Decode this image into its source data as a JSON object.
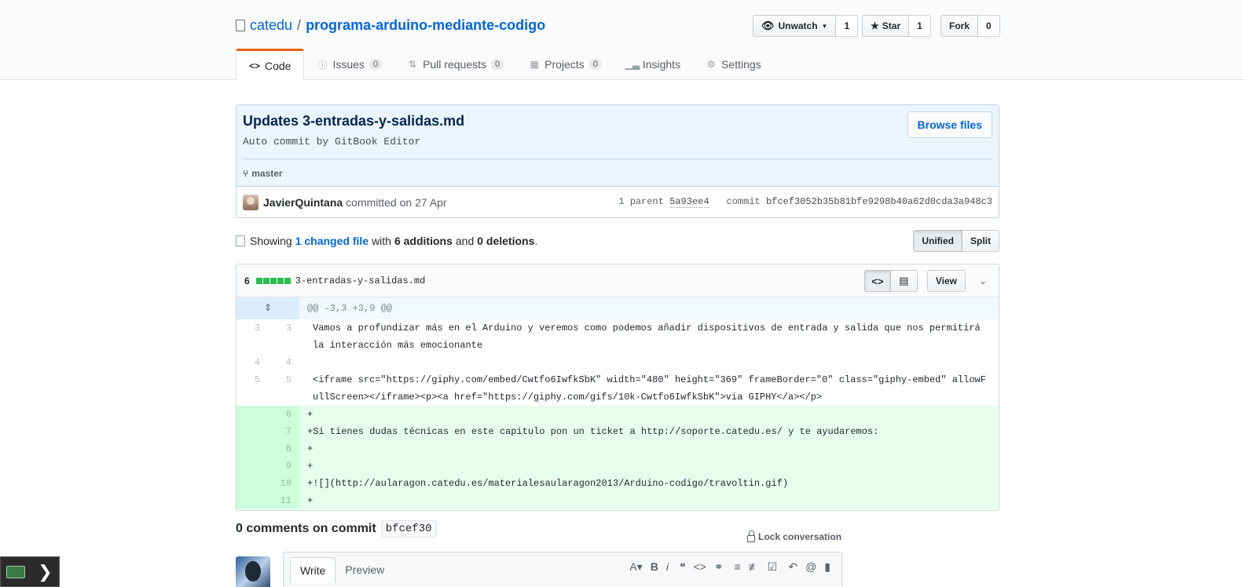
{
  "repo": {
    "owner": "catedu",
    "separator": "/",
    "name": "programa-arduino-mediante-codigo"
  },
  "actions": {
    "watch": {
      "label": "Unwatch",
      "count": "1"
    },
    "star": {
      "label": "Star",
      "count": "1"
    },
    "fork": {
      "label": "Fork",
      "count": "0"
    }
  },
  "tabs": [
    {
      "label": "Code"
    },
    {
      "label": "Issues",
      "count": "0"
    },
    {
      "label": "Pull requests",
      "count": "0"
    },
    {
      "label": "Projects",
      "count": "0"
    },
    {
      "label": "Insights"
    },
    {
      "label": "Settings"
    }
  ],
  "commit": {
    "title": "Updates 3-entradas-y-salidas.md",
    "description": "Auto commit by GitBook Editor",
    "browse_label": "Browse files",
    "branch": "master",
    "author": "JavierQuintana",
    "committed": "committed on 27 Apr",
    "parent_label": "1 parent",
    "parent_sha": "5a93ee4",
    "commit_label": "commit",
    "sha": "bfcef3052b35b81bfe9298b40a62d0cda3a948c3"
  },
  "toc": {
    "showing": "Showing",
    "changed": "1 changed file",
    "with": "with",
    "additions": "6 additions",
    "and": "and",
    "deletions": "0 deletions",
    "period": ".",
    "unified": "Unified",
    "split": "Split"
  },
  "file": {
    "count": "6",
    "name": "3-entradas-y-salidas.md",
    "view_label": "View",
    "hunk": "@@ -3,3 +3,9 @@",
    "lines": [
      {
        "old": "3",
        "new": "3",
        "type": "ctx",
        "text": "Vamos a profundizar más en el Arduino y veremos como podemos añadir dispositivos de entrada y salida que nos permitirá la interacción más emocionante"
      },
      {
        "old": "4",
        "new": "4",
        "type": "ctx",
        "text": ""
      },
      {
        "old": "5",
        "new": "5",
        "type": "ctx",
        "text": "<iframe src=\"https://giphy.com/embed/Cwtfo6IwfkSbK\" width=\"480\" height=\"369\" frameBorder=\"0\" class=\"giphy-embed\" allowFullScreen></iframe><p><a href=\"https://giphy.com/gifs/10k-Cwtfo6IwfkSbK\">via GIPHY</a></p>"
      },
      {
        "old": "",
        "new": "6",
        "type": "add",
        "text": "+"
      },
      {
        "old": "",
        "new": "7",
        "type": "add",
        "text": "+Si tienes dudas técnicas en este capitulo pon un ticket a http://soporte.catedu.es/ y te ayudaremos:"
      },
      {
        "old": "",
        "new": "8",
        "type": "add",
        "text": "+"
      },
      {
        "old": "",
        "new": "9",
        "type": "add",
        "text": "+"
      },
      {
        "old": "",
        "new": "10",
        "type": "add",
        "text": "+![](http://aularagon.catedu.es/materialesaularagon2013/Arduino-codigo/travoltin.gif)"
      },
      {
        "old": "",
        "new": "11",
        "type": "add",
        "text": "+"
      }
    ]
  },
  "comments": {
    "title": "0 comments on commit",
    "sha": "bfcef30",
    "lock_label": "Lock conversation",
    "write_tab": "Write",
    "preview_tab": "Preview"
  },
  "colors": {
    "accent": "#0366d6",
    "tab_active": "#e36209",
    "addition": "#2cbe4e",
    "add_bg": "#e6ffed"
  },
  "icons": [
    "repo-icon",
    "eye-icon",
    "star-icon",
    "code-icon",
    "issue-icon",
    "pull-request-icon",
    "project-icon",
    "graph-icon",
    "gear-icon",
    "branch-icon",
    "file-icon",
    "lock-icon",
    "unfold-icon",
    "chevron-down-icon"
  ]
}
